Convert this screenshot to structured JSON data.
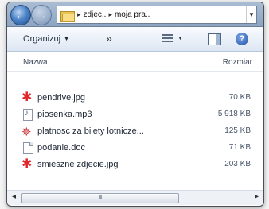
{
  "addressbar": {
    "crumbs": [
      "zdjec..",
      "moja pra.."
    ],
    "separator": "▸"
  },
  "toolbar": {
    "organize_label": "Organizuj",
    "more_label": "»",
    "help_label": "?"
  },
  "columns": {
    "name": "Nazwa",
    "size": "Rozmiar"
  },
  "files": [
    {
      "name": "pendrive.jpg",
      "size": "70 KB",
      "icon": "jpg-image-icon"
    },
    {
      "name": "piosenka.mp3",
      "size": "5 918 KB",
      "icon": "mp3-audio-icon"
    },
    {
      "name": "platnosc za bilety lotnicze...",
      "size": "125 KB",
      "icon": "pdf-document-icon"
    },
    {
      "name": "podanie.doc",
      "size": "71 KB",
      "icon": "doc-document-icon"
    },
    {
      "name": "smieszne zdjecie.jpg",
      "size": "203 KB",
      "icon": "jpg-image-icon"
    }
  ],
  "scrollbar": {
    "left_arrow": "◂",
    "right_arrow": "▸",
    "grip": "III"
  },
  "colors": {
    "accent": "#1d4ea7",
    "image_icon": "#e0262b",
    "pdf_icon": "#c5262b"
  }
}
